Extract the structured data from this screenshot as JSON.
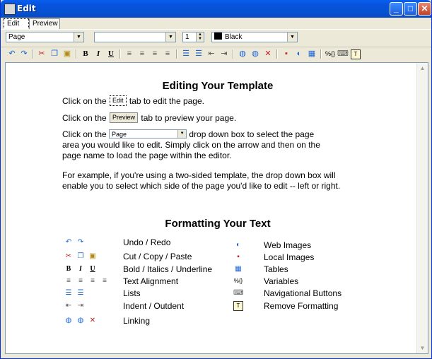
{
  "window": {
    "title": "Edit"
  },
  "tabs": {
    "edit": "Edit",
    "preview": "Preview"
  },
  "format": {
    "block_value": "Page",
    "font_value": "",
    "size_value": "1",
    "color_value": "Black",
    "color_hex": "#000000"
  },
  "icons": [
    "undo-icon",
    "redo-icon",
    "cut-icon",
    "copy-icon",
    "paste-icon",
    "bold-icon",
    "italic-icon",
    "underline-icon",
    "align-left-icon",
    "align-center-icon",
    "align-right-icon",
    "justify-icon",
    "numbered-list-icon",
    "bulleted-list-icon",
    "outdent-icon",
    "indent-icon",
    "web-link-icon",
    "email-link-icon",
    "remove-link-icon",
    "local-image-icon",
    "web-image-icon",
    "table-icon",
    "variable-icon",
    "nav-button-icon",
    "remove-format-icon"
  ],
  "content": {
    "heading1": "Editing Your Template",
    "line_edit_pre": "Click on the",
    "line_edit_post": "tab to edit the page.",
    "line_preview_pre": "Click on the",
    "line_preview_post": "tab to preview your page.",
    "line_dropdown_pre": "Click on the",
    "line_dropdown_post": "drop down box to select the page",
    "dropdown_line2": "area you would like to edit. Simply click on the arrow and then on the",
    "dropdown_line3": "page name to load the page within the editor.",
    "example_line1": "For example, if you're using a two-sided template, the drop down box will",
    "example_line2": "enable you to select which side of the page you'd like to edit -- left or right.",
    "heading2": "Formatting Your Text"
  },
  "legend_left": [
    "Undo / Redo",
    "Cut / Copy / Paste",
    "Bold / Italics / Underline",
    "Text Alignment",
    "Lists",
    "Indent / Outdent",
    "Linking"
  ],
  "legend_right": [
    "Web Images",
    "Local Images",
    "Tables",
    "Variables",
    "Navigational Buttons",
    "Remove Formatting"
  ],
  "toolbar_glyphs": {
    "bold": "B",
    "italic": "I",
    "underline": "U",
    "variable": "%{}"
  }
}
